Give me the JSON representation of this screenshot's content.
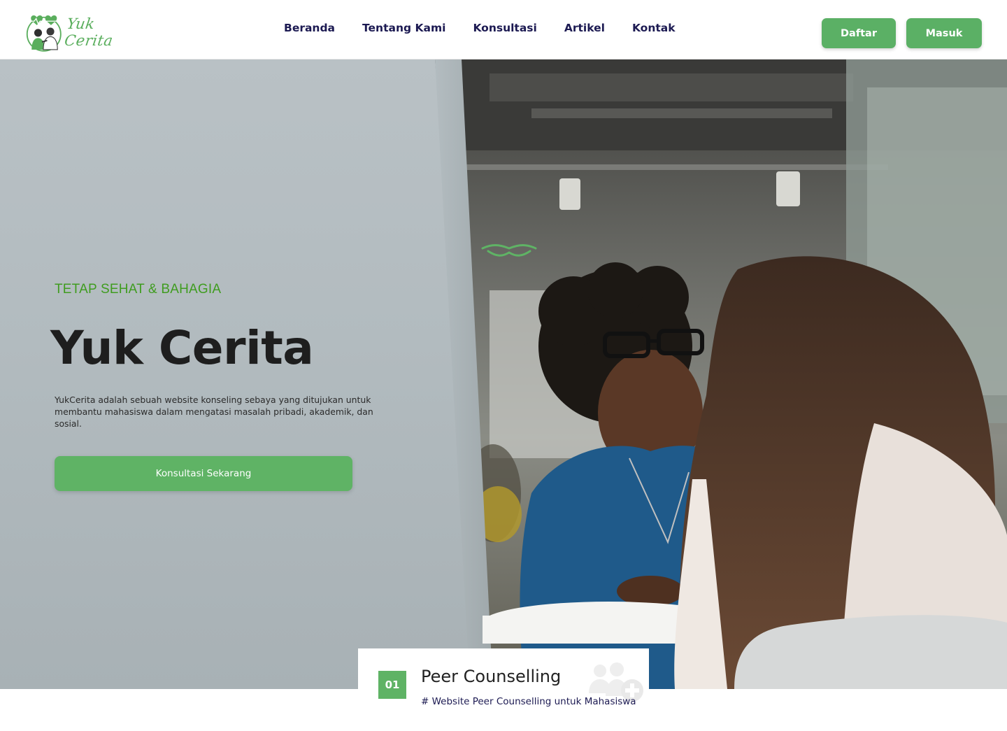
{
  "brand": {
    "name": "Yuk Cerita"
  },
  "nav": {
    "items": [
      {
        "label": "Beranda"
      },
      {
        "label": "Tentang Kami"
      },
      {
        "label": "Konsultasi"
      },
      {
        "label": "Artikel"
      },
      {
        "label": "Kontak"
      }
    ],
    "register_label": "Daftar",
    "login_label": "Masuk"
  },
  "hero": {
    "eyebrow": "TETAP SEHAT & BAHAGIA",
    "title": "Yuk Cerita",
    "description": "YukCerita adalah sebuah website konseling sebaya yang ditujukan untuk membantu mahasiswa dalam mengatasi masalah pribadi, akademik, dan sosial.",
    "cta_label": "Konsultasi Sekarang"
  },
  "feature_card": {
    "number": "01",
    "title": "Peer Counselling",
    "subtitle": "# Website Peer Counselling untuk Mahasiswa",
    "icon": "people-plus-icon"
  },
  "colors": {
    "accent_green": "#5fb365",
    "eyebrow_green": "#3f9c1f",
    "nav_text": "#1c1a52",
    "title_text": "#1e1e1e"
  }
}
